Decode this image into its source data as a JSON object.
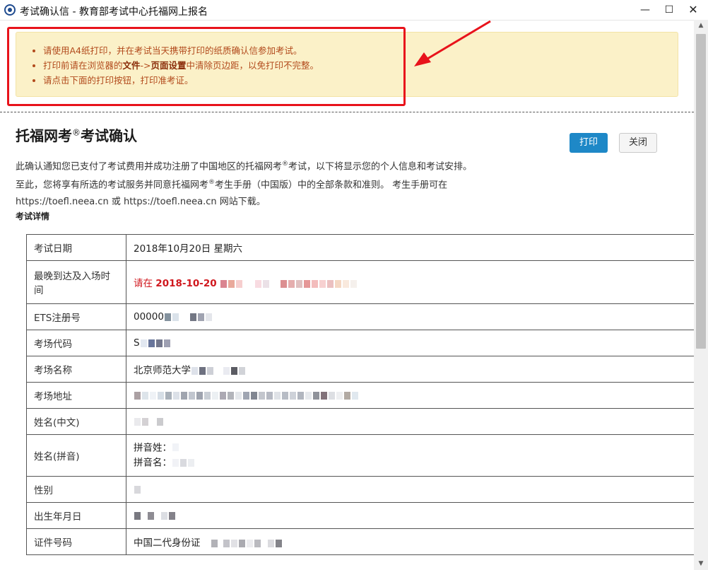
{
  "window": {
    "title": "考试确认信 - 教育部考试中心托福网上报名",
    "minimize": "—",
    "maximize": "☐",
    "close": "✕"
  },
  "notice": {
    "items": [
      {
        "text": "请使用A4纸打印，并在考试当天携带打印的纸质确认信参加考试。"
      },
      {
        "pre": "打印前请在浏览器的",
        "bold1": "文件",
        "mid": "->",
        "bold2": "页面设置",
        "post": "中清除页边距，以免打印不完整。"
      },
      {
        "text": "请点击下面的打印按钮，打印准考证。"
      }
    ],
    "highlight_color": "#e8131b"
  },
  "page": {
    "title_main": "托福网考",
    "title_sup": "®",
    "title_rest": "考试确认",
    "print_label": "打印",
    "close_label": "关闭",
    "intro": {
      "line1_a": "此确认通知您已支付了考试费用并成功注册了中国地区的托福网考",
      "line1_sup": "®",
      "line1_b": "考试，以下将显示您的个人信息和考试安排。",
      "line2_a": "至此，您将享有所选的考试服务并同意托福网考",
      "line2_sup": "®",
      "line2_b": "考生手册（中国版）中的全部条款和准则。 考生手册可在",
      "line3": "https://toefl.neea.cn 或 https://toefl.neea.cn 网站下载。"
    },
    "section_label": "考试详情"
  },
  "details": {
    "rows": [
      {
        "label": "考试日期",
        "value": "2018年10月20日 星期六"
      },
      {
        "label": "最晚到达及入场时间",
        "value_prefix": "请在 ",
        "value_bold": "2018-10-20"
      },
      {
        "label": "ETS注册号",
        "value": "00000"
      },
      {
        "label": "考场代码",
        "value": "S"
      },
      {
        "label": "考场名称",
        "value": "北京师范大学"
      },
      {
        "label": "考场地址",
        "value": ""
      },
      {
        "label": "姓名(中文)",
        "value": ""
      },
      {
        "label": "姓名(拼音)",
        "sub1": "拼音姓：",
        "sub2": "拼音名："
      },
      {
        "label": "性别",
        "value": ""
      },
      {
        "label": "出生年月日",
        "value": ""
      },
      {
        "label": "证件号码",
        "value": "中国二代身份证"
      }
    ]
  },
  "colors": {
    "print_button": "#1e88c7",
    "notice_bg": "#fbf1c8",
    "notice_text": "#b24a1c",
    "alert_red": "#d0181e"
  },
  "icons": {
    "app": "app-logo-icon",
    "arrow": "red-arrow-annotation",
    "scroll_up": "scroll-up-arrow-icon",
    "scroll_down": "scroll-down-arrow-icon"
  }
}
